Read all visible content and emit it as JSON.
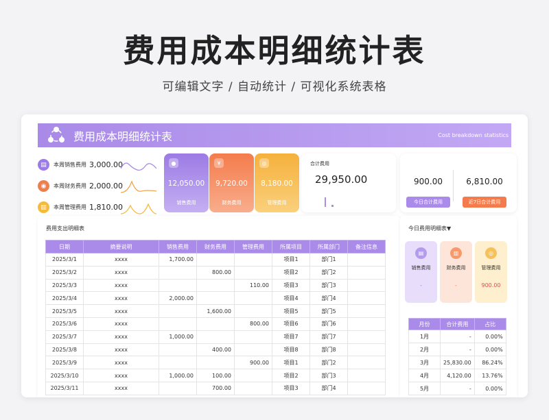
{
  "page": {
    "title": "费用成本明细统计表",
    "subtitle": "可编辑文字 / 自动统计 / 可视化系统表格"
  },
  "header": {
    "title": "费用成本明细统计表",
    "subtitle_en": "Cost breakdown statistics"
  },
  "weekly_costs": [
    {
      "label": "本周销售费用",
      "value": "3,000.00",
      "icon": "sales-icon",
      "color": "#9c7be4"
    },
    {
      "label": "本周财务费用",
      "value": "2,000.00",
      "icon": "finance-icon",
      "color": "#f47c4c"
    },
    {
      "label": "本周管理费用",
      "value": "1,810.00",
      "icon": "manage-icon",
      "color": "#f5b93c"
    }
  ],
  "tiles": [
    {
      "label": "销售费用",
      "value": "12,050.00",
      "icon": "sales-icon"
    },
    {
      "label": "财务费用",
      "value": "9,720.00",
      "icon": "finance-icon",
      "glyph": "¥"
    },
    {
      "label": "管理费用",
      "value": "8,180.00",
      "icon": "manage-icon"
    }
  ],
  "total": {
    "label": "合计费用",
    "value": "29,950.00"
  },
  "today_summary": {
    "today_value": "900.00",
    "today_btn": "今日合计费用",
    "week_value": "6,810.00",
    "week_btn": "近7日合计费用"
  },
  "detail": {
    "title": "费用支出明细表",
    "headers": [
      "日期",
      "摘要说明",
      "销售费用",
      "财务费用",
      "管理费用",
      "所属项目",
      "所属部门",
      "备注信息"
    ],
    "rows": [
      [
        "2025/3/1",
        "xxxx",
        "1,700.00",
        "",
        "",
        "项目1",
        "部门1",
        ""
      ],
      [
        "2025/3/2",
        "xxxx",
        "",
        "800.00",
        "",
        "项目2",
        "部门2",
        ""
      ],
      [
        "2025/3/3",
        "xxxx",
        "",
        "",
        "110.00",
        "项目3",
        "部门3",
        ""
      ],
      [
        "2025/3/4",
        "xxxx",
        "2,000.00",
        "",
        "",
        "项目4",
        "部门4",
        ""
      ],
      [
        "2025/3/5",
        "xxxx",
        "",
        "1,600.00",
        "",
        "项目5",
        "部门5",
        ""
      ],
      [
        "2025/3/6",
        "xxxx",
        "",
        "",
        "800.00",
        "项目6",
        "部门6",
        ""
      ],
      [
        "2025/3/7",
        "xxxx",
        "1,000.00",
        "",
        "",
        "项目7",
        "部门7",
        ""
      ],
      [
        "2025/3/8",
        "xxxx",
        "",
        "400.00",
        "",
        "项目8",
        "部门8",
        ""
      ],
      [
        "2025/3/9",
        "xxxx",
        "",
        "",
        "900.00",
        "项目1",
        "部门2",
        ""
      ],
      [
        "2025/3/10",
        "xxxx",
        "1,000.00",
        "100.00",
        "",
        "项目2",
        "部门3",
        ""
      ],
      [
        "2025/3/11",
        "xxxx",
        "",
        "700.00",
        "",
        "项目3",
        "部门4",
        ""
      ]
    ]
  },
  "today_detail": {
    "title": "今日费用明细表▼",
    "cards": [
      {
        "label": "销售费用",
        "value": "-",
        "icon": "sales-icon"
      },
      {
        "label": "财务费用",
        "value": "-",
        "icon": "finance-icon"
      },
      {
        "label": "管理费用",
        "value": "900.00",
        "icon": "manage-icon"
      }
    ]
  },
  "monthly": {
    "headers": [
      "月份",
      "合计费用",
      "占比"
    ],
    "rows": [
      [
        "1月",
        "-",
        "0.00%"
      ],
      [
        "2月",
        "-",
        "0.00%"
      ],
      [
        "3月",
        "25,830.00",
        "86.24%"
      ],
      [
        "4月",
        "4,120.00",
        "13.76%"
      ],
      [
        "5月",
        "-",
        "0.00%"
      ]
    ]
  }
}
